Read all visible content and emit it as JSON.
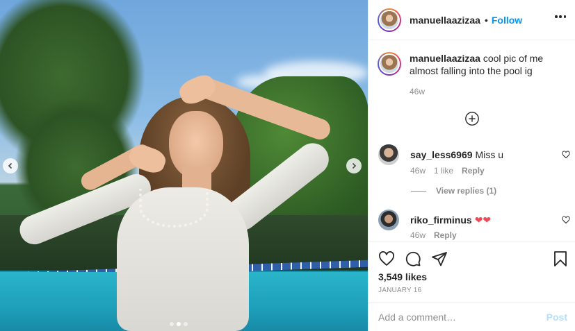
{
  "post": {
    "image_alt": "photo",
    "carousel_count": 3,
    "carousel_active_index": 1
  },
  "header": {
    "username": "manuellaazizaa",
    "separator": "•",
    "follow_label": "Follow"
  },
  "caption": {
    "username": "manuellaazizaa",
    "text": "cool pic of me almost falling into the pool ig",
    "time": "46w"
  },
  "comments": [
    {
      "username": "say_less6969",
      "text": "Miss u",
      "time": "46w",
      "likes": "1 like",
      "reply_label": "Reply",
      "view_replies": "View replies (1)"
    },
    {
      "username": "riko_firminus",
      "text": "❤❤",
      "time": "46w",
      "reply_label": "Reply"
    }
  ],
  "actions": {
    "likes": "3,549 likes",
    "date": "JANUARY 16"
  },
  "add_comment": {
    "placeholder": "Add a comment…",
    "post_label": "Post"
  },
  "icons": [
    "heart-icon",
    "comment-icon",
    "share-icon",
    "bookmark-icon",
    "more-icon",
    "plus-circle-icon",
    "chevron-left-icon",
    "chevron-right-icon"
  ],
  "colors": {
    "accent": "#0095f6",
    "text": "#262626",
    "muted": "#8e8e8e",
    "heart_red": "#ed4956",
    "post_disabled": "#b2dffc"
  }
}
